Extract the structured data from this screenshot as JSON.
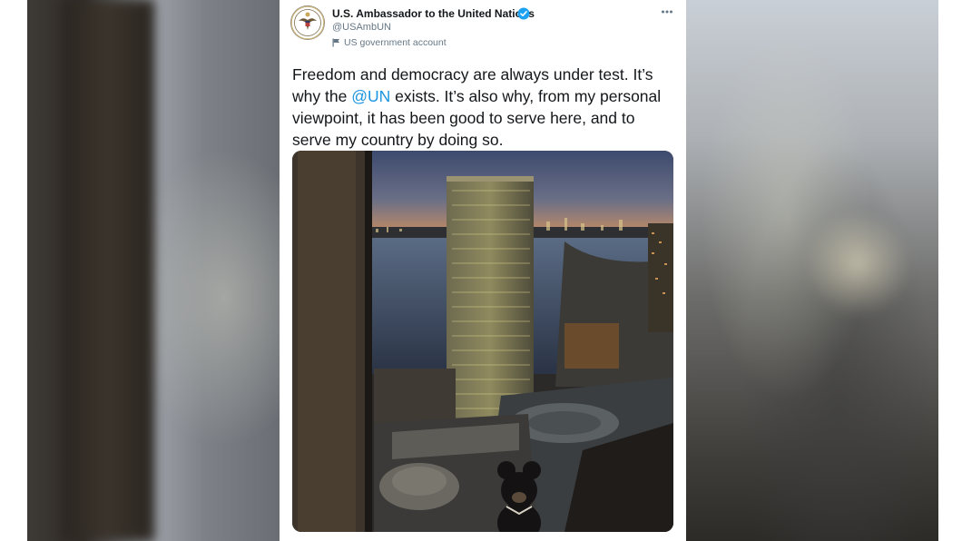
{
  "tweet": {
    "display_name": "U.S. Ambassador to the United Nations",
    "handle": "@USAmbUN",
    "account_label": "US government account",
    "text_before": "Freedom and democracy are always under test. It’s why the ",
    "mention": "@UN",
    "text_after": " exists. It’s also why, from my personal viewpoint, it has been good to serve here, and to serve my country by doing so."
  },
  "icons": {
    "avatar": "state-seal-icon",
    "verified": "verified-badge-icon",
    "account_flag": "flag-icon",
    "more": "more-options-icon"
  },
  "colors": {
    "link": "#1b95e0",
    "verified": "#1da1f2",
    "text": "#14171a",
    "secondary_text": "#657786"
  }
}
